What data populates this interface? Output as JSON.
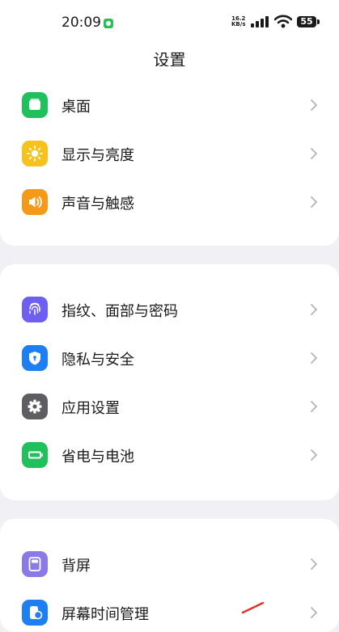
{
  "status_bar": {
    "time": "20:09",
    "speed_value": "16.2",
    "speed_unit": "KB/s",
    "battery": "55",
    "icons": [
      "chat-icon",
      "signal-icon",
      "wifi-icon",
      "battery-icon"
    ]
  },
  "header": {
    "title": "设置"
  },
  "groups": [
    {
      "items": [
        {
          "label": "桌面",
          "icon": "desktop-icon",
          "color": "#20c15c"
        },
        {
          "label": "显示与亮度",
          "icon": "brightness-icon",
          "color": "#f7c21c"
        },
        {
          "label": "声音与触感",
          "icon": "sound-icon",
          "color": "#f59a18"
        }
      ]
    },
    {
      "items": [
        {
          "label": "指纹、面部与密码",
          "icon": "fingerprint-icon",
          "color": "#6e5ef2"
        },
        {
          "label": "隐私与安全",
          "icon": "privacy-shield-icon",
          "color": "#1d7ff2"
        },
        {
          "label": "应用设置",
          "icon": "gear-icon",
          "color": "#5e5e62"
        },
        {
          "label": "省电与电池",
          "icon": "battery-saver-icon",
          "color": "#20c15c"
        }
      ]
    },
    {
      "items": [
        {
          "label": "背屏",
          "icon": "back-screen-icon",
          "color": "#8b7ae6"
        },
        {
          "label": "屏幕时间管理",
          "icon": "screen-time-icon",
          "color": "#1d7ff2"
        }
      ]
    }
  ]
}
